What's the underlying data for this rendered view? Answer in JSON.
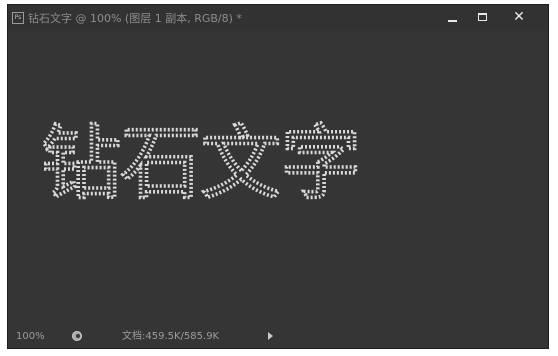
{
  "window": {
    "title": "钻石文字 @ 100% (图层 1 副本, RGB/8) *",
    "app_icon": "Ps"
  },
  "controls": {
    "minimize_icon": "minimize-icon",
    "maximize_icon": "maximize-icon",
    "close_icon": "close-icon",
    "close_glyph": "✕"
  },
  "canvas": {
    "text": "钻石文字",
    "stroke_color": "#d9d9d9",
    "background_color": "#353535"
  },
  "status": {
    "zoom": "100%",
    "doc_label": "文档:459.5K/585.9K"
  }
}
